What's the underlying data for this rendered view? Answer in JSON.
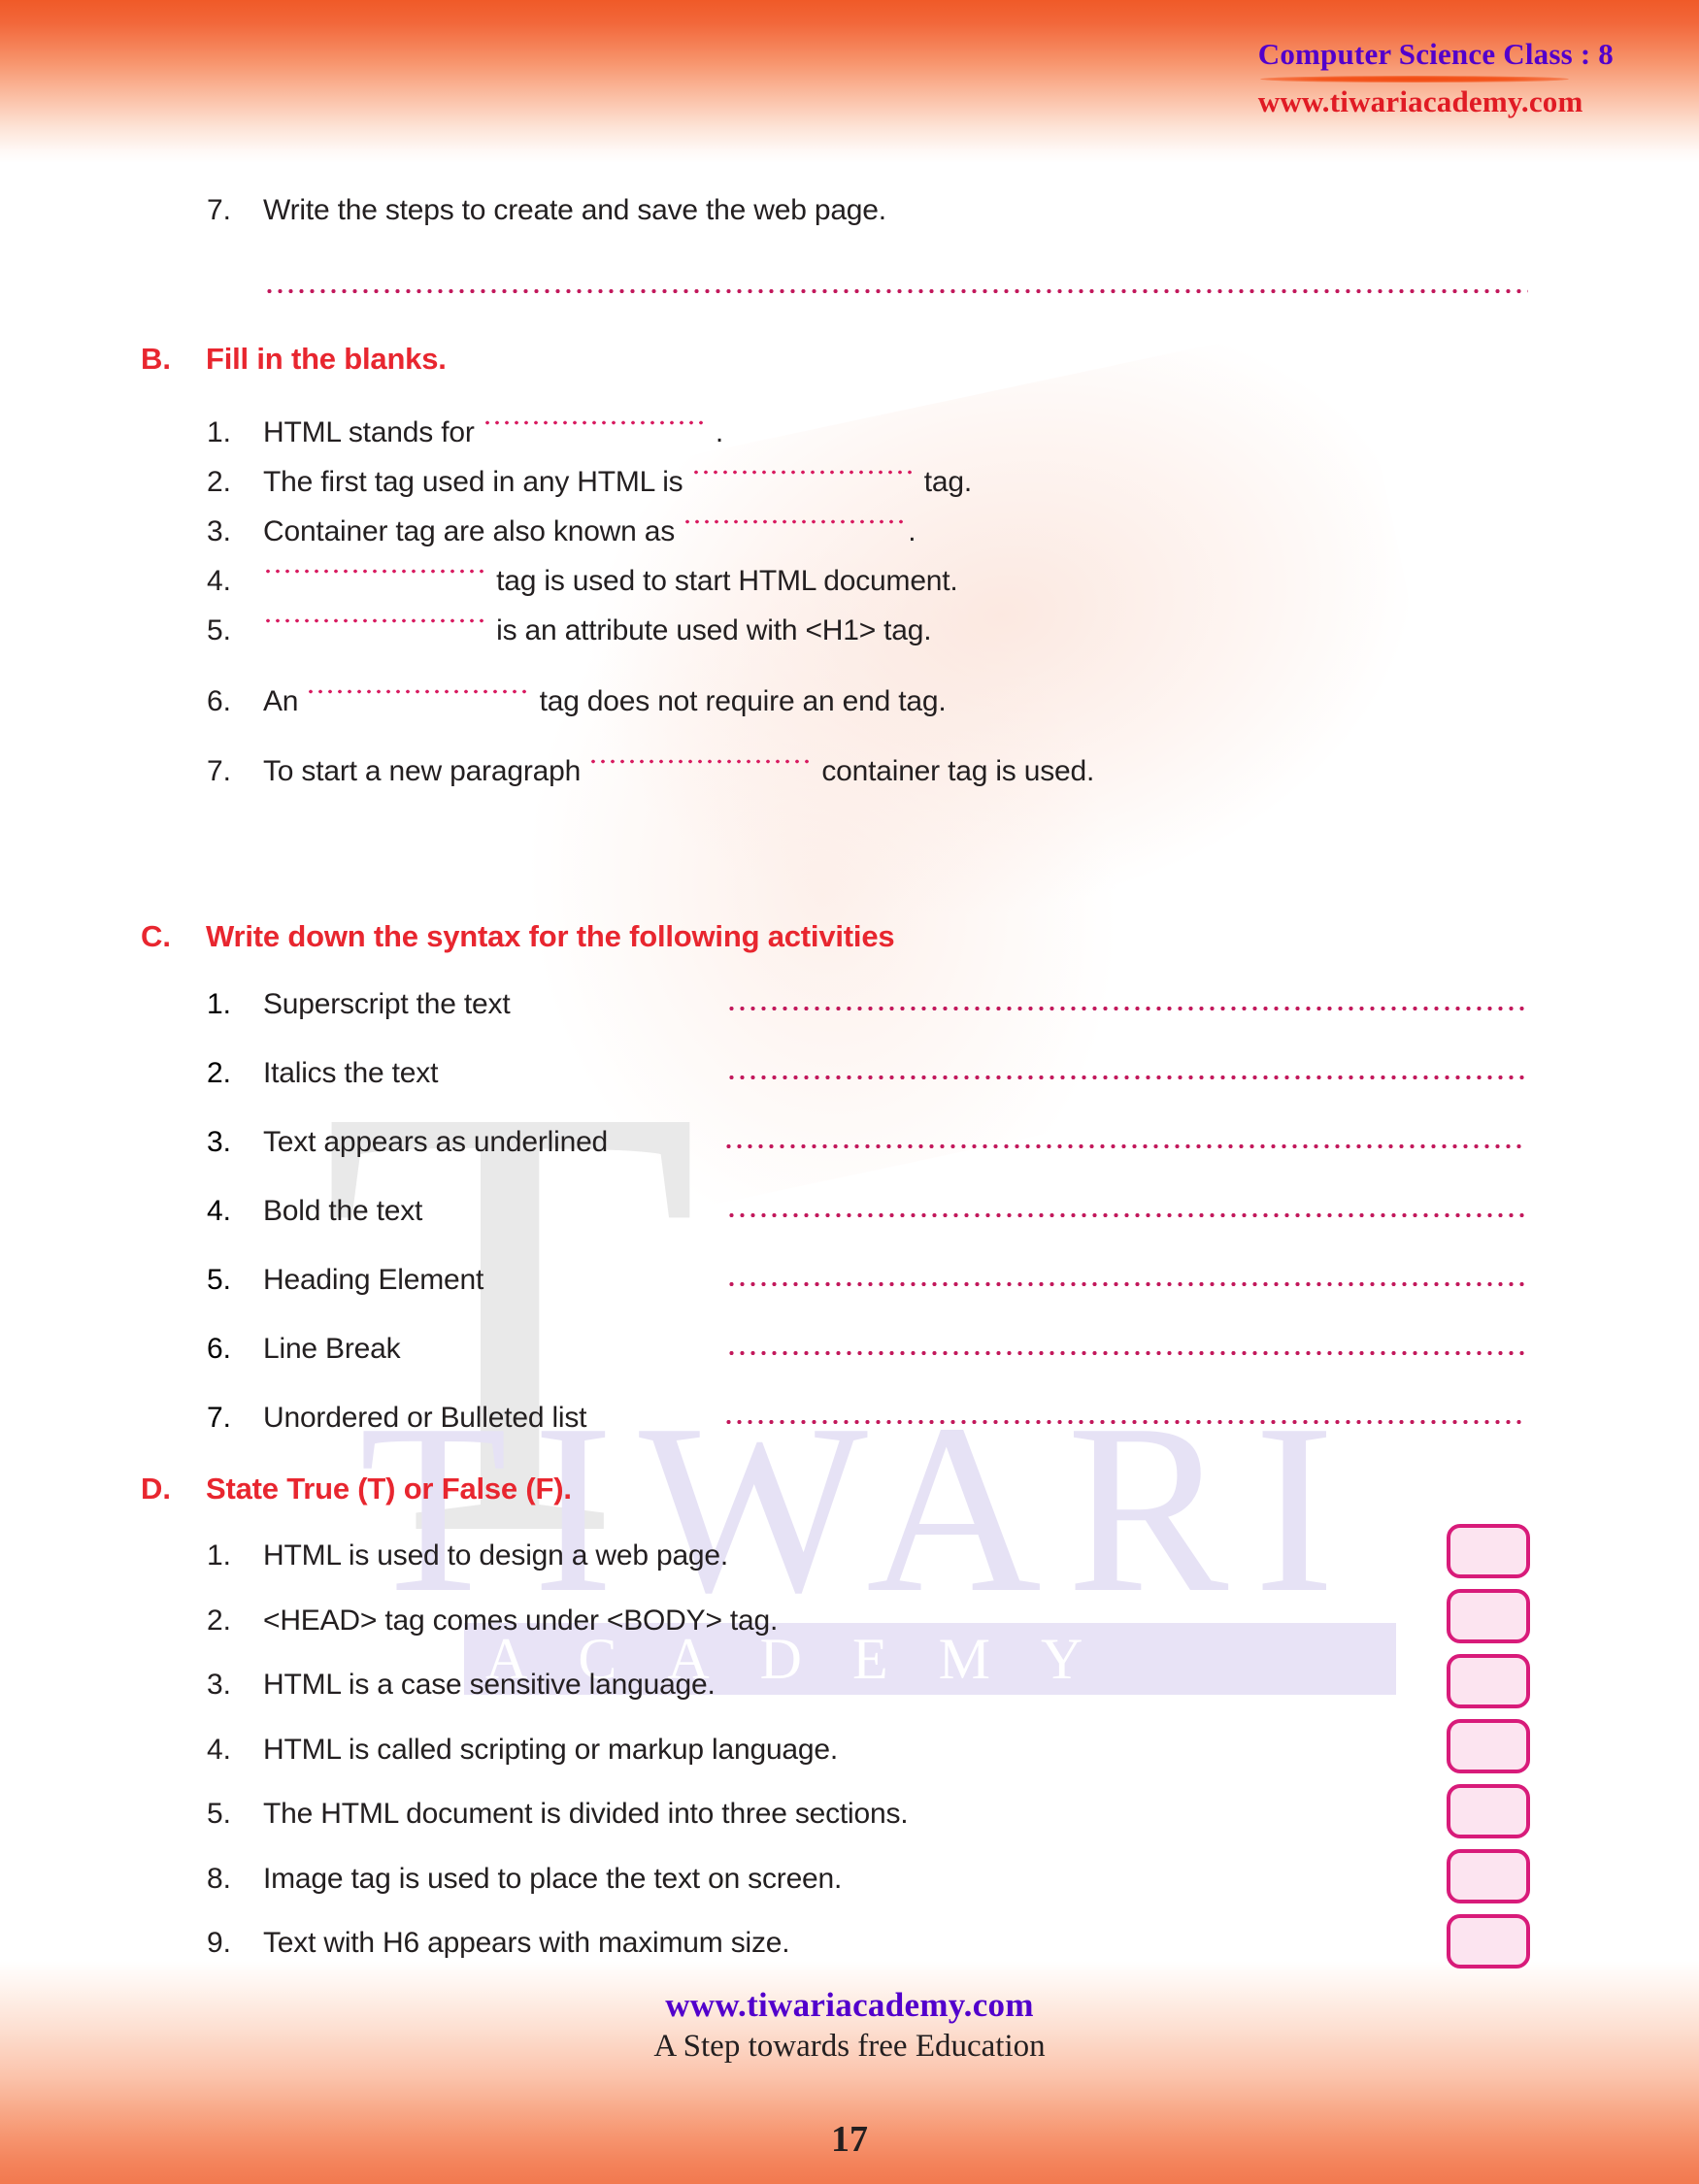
{
  "header": {
    "subject": "Computer Science Class : 8",
    "site": "www.tiwariacademy.com"
  },
  "watermark": {
    "letter": "T",
    "brand": "TIWARI",
    "brand_sub": "ACADEMY"
  },
  "top_question": {
    "number": "7.",
    "text": "Write the steps to create and save the web page."
  },
  "sections": [
    {
      "label": "B.",
      "title": "Fill in the blanks.",
      "items": [
        {
          "number": "1.",
          "before": "HTML stands for ",
          "blank_width": 232,
          "after": " ."
        },
        {
          "number": "2.",
          "before": "The first tag used in any HTML is ",
          "blank_width": 232,
          "after": " tag."
        },
        {
          "number": "3.",
          "before": "Container tag are also known as ",
          "blank_width": 232,
          "after": "."
        },
        {
          "number": "4.",
          "before": "",
          "blank_width": 232,
          "after": " tag is used to start HTML document."
        },
        {
          "number": "5.",
          "before": "",
          "blank_width": 232,
          "after": " is an attribute used with <H1> tag."
        },
        {
          "number": "6.",
          "before": "An ",
          "blank_width": 232,
          "after": " tag does not require an end tag."
        },
        {
          "number": "7.",
          "before": "To start a new paragraph ",
          "blank_width": 232,
          "after": " container tag is used."
        }
      ]
    },
    {
      "label": "C.",
      "title": "Write down the syntax for the following activities",
      "items": [
        {
          "number": "1.",
          "label": "Superscript the text"
        },
        {
          "number": "2.",
          "label": "Italics the text"
        },
        {
          "number": "3.",
          "label": "Text appears as underlined"
        },
        {
          "number": "4.",
          "label": "Bold the text"
        },
        {
          "number": "5.",
          "label": "Heading Element"
        },
        {
          "number": "6.",
          "label": "Line Break"
        },
        {
          "number": "7.",
          "label": "Unordered or Bulleted list"
        }
      ]
    },
    {
      "label": "D.",
      "title": "State True (T) or False (F).",
      "items": [
        {
          "number": "1.",
          "label": "HTML is used to design a web page."
        },
        {
          "number": "2.",
          "label": "<HEAD> tag comes under <BODY> tag."
        },
        {
          "number": "3.",
          "label": "HTML is a case sensitive language."
        },
        {
          "number": "4.",
          "label": "HTML is called scripting or markup language."
        },
        {
          "number": "5.",
          "label": "The HTML document is divided into three sections."
        },
        {
          "number": "8.",
          "label": "Image tag is used to place the text on screen."
        },
        {
          "number": "9.",
          "label": "Text with H6 appears with maximum size."
        }
      ]
    }
  ],
  "footer": {
    "site": "www.tiwariacademy.com",
    "tagline": "A Step towards free Education",
    "page_number": "17"
  },
  "colors": {
    "accent_orange": "#f05a28",
    "heading_red": "#e8262f",
    "brand_purple": "#5200cc",
    "brand_red": "#e01b24",
    "dotted_pink": "#d81b60",
    "box_border": "#d81b7a",
    "box_fill": "#fce4f0"
  }
}
